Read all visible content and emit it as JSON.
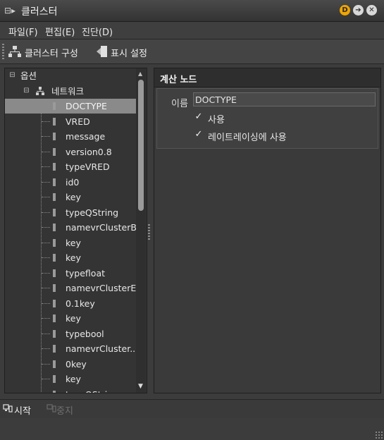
{
  "window": {
    "title": "클러스터"
  },
  "titlebar_buttons": {
    "d_badge": "D",
    "arrow": "➔",
    "close": "✕"
  },
  "menu": [
    {
      "label": "파일(F)"
    },
    {
      "label": "편집(E)"
    },
    {
      "label": "진단(D)"
    }
  ],
  "toolbar": {
    "cluster_config": "클러스터 구성",
    "display_settings": "표시 설정"
  },
  "tree": {
    "root": "옵션",
    "network": "네트워크",
    "nodes": [
      "DOCTYPE",
      "VRED",
      "message",
      "version0.8",
      "typeVRED",
      "id0",
      "key",
      "typeQString",
      "namevrClusterB...",
      "key",
      "key",
      "typefloat",
      "namevrClusterE...",
      "0.1key",
      "key",
      "typebool",
      "namevrCluster...",
      "0key",
      "key",
      "typeQString"
    ],
    "selected_index": 0
  },
  "detail": {
    "title": "계산 노드",
    "name_label": "이름",
    "name_value": "DOCTYPE",
    "use_label": "사용",
    "use_checked": true,
    "raytracing_label": "레이트레이싱에 사용",
    "raytracing_checked": true
  },
  "bottom": {
    "start_label": "시작",
    "stop_label": "중지"
  },
  "colors": {
    "accent_badge": "#f0a500",
    "selection": "#8a8a8a",
    "background": "#3c3c3c"
  }
}
